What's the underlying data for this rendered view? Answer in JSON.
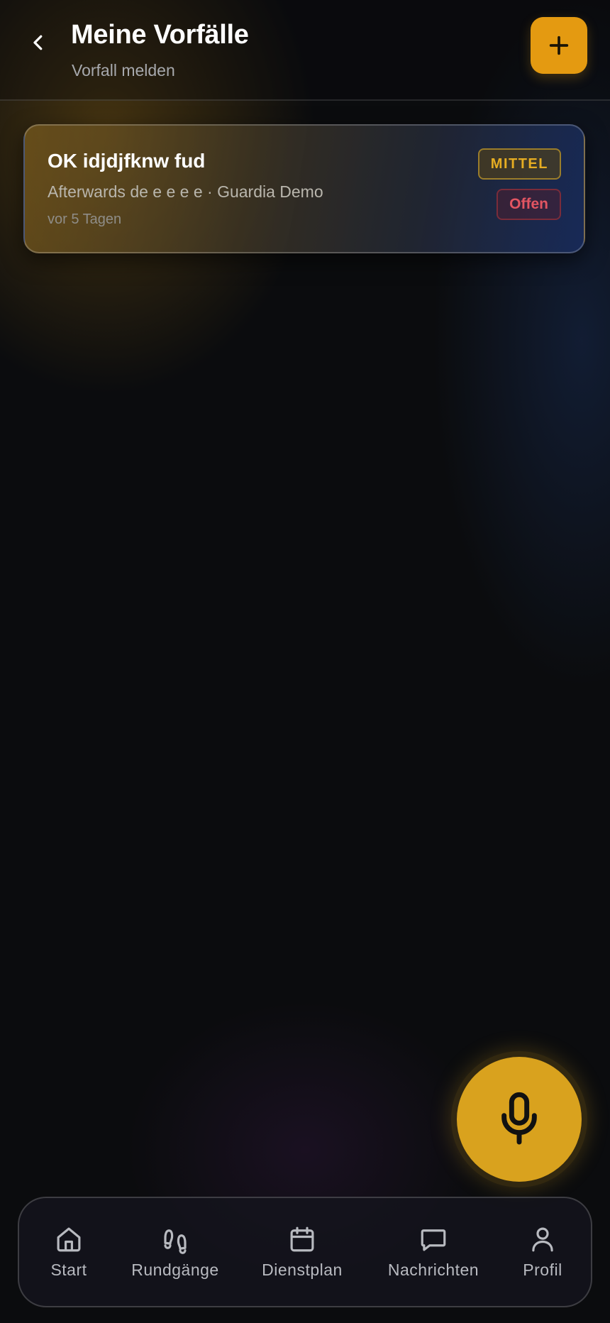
{
  "header": {
    "title": "Meine Vorfälle",
    "subtitle": "Vorfall melden",
    "back_icon": "chevron-left-icon",
    "add_icon": "plus-icon"
  },
  "incidents": [
    {
      "title": "OK idjdjfknw fud",
      "meta": "Afterwards de e e e e · Guardia Demo",
      "time": "vor 5 Tagen",
      "priority": "MITTEL",
      "status": "Offen"
    }
  ],
  "fab": {
    "icon": "microphone-icon"
  },
  "nav": {
    "items": [
      {
        "label": "Start",
        "icon": "home-icon"
      },
      {
        "label": "Rundgänge",
        "icon": "footprints-icon"
      },
      {
        "label": "Dienstplan",
        "icon": "calendar-icon"
      },
      {
        "label": "Nachrichten",
        "icon": "message-icon"
      },
      {
        "label": "Profil",
        "icon": "user-icon"
      }
    ]
  },
  "colors": {
    "accent": "#e49a11",
    "mic": "#d9a21e",
    "priority_medium": "#e6ad22",
    "status_open": "#e25562",
    "background": "#0b0c0e"
  }
}
